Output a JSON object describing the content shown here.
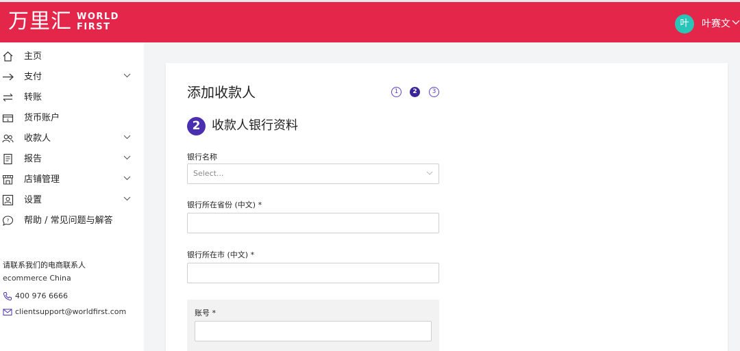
{
  "header": {
    "logo_cn": "万里汇",
    "logo_en_line1": "WORLD",
    "logo_en_line2": "FIRST",
    "avatar_initial": "叶",
    "username": "叶赛文",
    "brand_color": "#e5264b"
  },
  "sidebar": {
    "items": [
      {
        "label": "主页",
        "icon": "home-icon"
      },
      {
        "label": "支付",
        "icon": "arrow-right-icon"
      },
      {
        "label": "转账",
        "icon": "transfer-icon"
      },
      {
        "label": "货币账户",
        "icon": "wallet-icon"
      },
      {
        "label": "收款人",
        "icon": "users-icon"
      },
      {
        "label": "报告",
        "icon": "report-icon"
      },
      {
        "label": "店铺管理",
        "icon": "store-icon"
      },
      {
        "label": "设置",
        "icon": "settings-icon"
      },
      {
        "label": "帮助 / 常见问题与解答",
        "icon": "help-icon"
      }
    ],
    "contact": {
      "title": "请联系我们的电商联系人",
      "subtitle": "ecommerce China",
      "phone": "400 976 6666",
      "email": "clientsupport@worldfirst.com"
    }
  },
  "main": {
    "title": "添加收款人",
    "steps": [
      "1",
      "2",
      "3"
    ],
    "active_step": 2,
    "section_number": "2",
    "section_title": "收款人银行资料",
    "fields": {
      "bank_name": {
        "label": "银行名称",
        "placeholder": "Select..."
      },
      "province": {
        "label": "银行所在省份 (中文) *",
        "value": ""
      },
      "city": {
        "label": "银行所在市 (中文) *",
        "value": ""
      },
      "account": {
        "label": "账号 *",
        "value": ""
      }
    },
    "accent_color": "#4a2fb0"
  }
}
